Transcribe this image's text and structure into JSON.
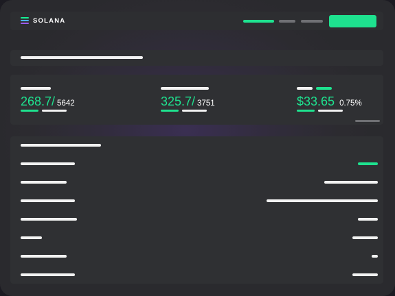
{
  "header": {
    "brand": "SOLANA",
    "logo_colors": [
      "#9d5cf0",
      "#4fb4e8",
      "#14f195"
    ]
  },
  "stats": [
    {
      "value": "268.7/",
      "total": "5642"
    },
    {
      "value": "325.7/",
      "total": "3751"
    },
    {
      "value": "$33.65",
      "change": "0.75%"
    }
  ],
  "colors": {
    "accent": "#1ee28f",
    "panel": "#2f3033",
    "text": "#ffffff"
  }
}
